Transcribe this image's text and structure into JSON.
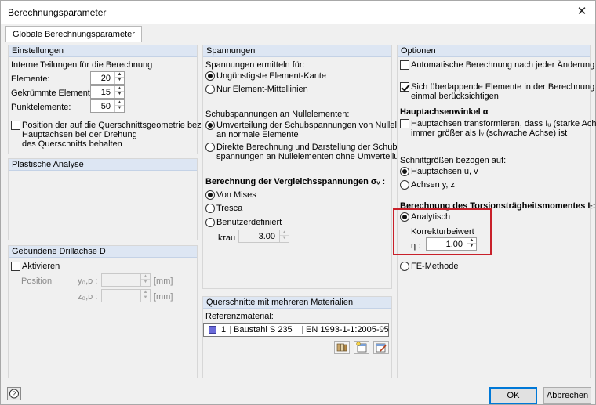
{
  "window": {
    "title": "Berechnungsparameter",
    "close_glyph": "✕"
  },
  "tabs": [
    {
      "label": "Globale Berechnungsparameter"
    }
  ],
  "einstellungen": {
    "header": "Einstellungen",
    "intro": "Interne Teilungen für die Berechnung",
    "elemente_label": "Elemente:",
    "elemente_value": "20",
    "gekruemmte_label": "Gekrümmte Elemente:",
    "gekruemmte_value": "15",
    "punkt_label": "Punktelemente:",
    "punkt_value": "50",
    "position_label_1": "Position der auf die Querschnittsgeometrie bezogenen",
    "position_label_2": "Hauptachsen bei der Drehung",
    "position_label_3": "des Querschnitts behalten",
    "position_checked": false
  },
  "plastische": {
    "header": "Plastische Analyse"
  },
  "drillachse": {
    "header": "Gebundene Drillachse D",
    "aktivieren_label": "Aktivieren",
    "aktivieren_checked": false,
    "position_label": "Position",
    "y_label": "y₀,ᴅ :",
    "y_unit": "[mm]",
    "y_value": "",
    "z_label": "z₀,ᴅ :",
    "z_unit": "[mm]",
    "z_value": ""
  },
  "spannungen": {
    "header": "Spannungen",
    "ermitteln_label": "Spannungen ermitteln für:",
    "opt_ungunstig": "Ungünstigste Element-Kante",
    "opt_ungunstig_checked": true,
    "opt_mittel": "Nur Element-Mittellinien",
    "opt_mittel_checked": false,
    "schub_label": "Schubspannungen an Nullelementen:",
    "opt_umvert_1": "Umverteilung der Schubspannungen von Nullelementen",
    "opt_umvert_2": "an normale Elemente",
    "opt_umvert_checked": true,
    "opt_direkt_1": "Direkte Berechnung und Darstellung der Schub-",
    "opt_direkt_2": "spannungen an Nullelementen ohne Umverteilung",
    "opt_direkt_checked": false,
    "vergleich_label": "Berechnung der Vergleichsspannungen σᵥ :",
    "opt_mises": "Von Mises",
    "opt_mises_checked": true,
    "opt_tresca": "Tresca",
    "opt_tresca_checked": false,
    "opt_benutzer": "Benutzerdefiniert",
    "opt_benutzer_checked": false,
    "ktau_label": "kτau",
    "ktau_value": "3.00"
  },
  "materialien": {
    "header": "Querschnitte mit mehreren Materialien",
    "referenz_label": "Referenzmaterial:",
    "material_no": "1",
    "material_name": "Baustahl S 235",
    "material_norm": "EN 1993-1-1:2005-05",
    "material_color": "#6a6ad8",
    "icons": [
      "library-icon",
      "new-material-icon",
      "edit-material-icon"
    ]
  },
  "optionen": {
    "header": "Optionen",
    "auto_label": "Automatische Berechnung nach jeder Änderung",
    "auto_checked": false,
    "overlap_label_1": "Sich überlappende Elemente in der Berechnung nur",
    "overlap_label_2": "einmal berücksichtigen",
    "overlap_checked": true,
    "hauptachsen_heading": "Hauptachsenwinkel α",
    "transform_label_1": "Hauptachsen transformieren, dass Iᵤ (starke Achse)",
    "transform_label_2": "immer größer als Iᵥ (schwache Achse) ist",
    "transform_checked": false,
    "schnitt_label": "Schnittgrößen bezogen auf:",
    "opt_uv": "Hauptachsen u, v",
    "opt_uv_checked": true,
    "opt_yz": "Achsen y, z",
    "opt_yz_checked": false,
    "torsion_label": "Berechnung des Torsionsträgheitsmomentes Iₜ:",
    "opt_analytisch": "Analytisch",
    "opt_analytisch_checked": true,
    "korrektur_label": "Korrekturbeiwert",
    "eta_label": "η :",
    "eta_value": "1.00",
    "opt_fe": "FE-Methode",
    "opt_fe_checked": false,
    "highlight_color": "#c8202a"
  },
  "footer": {
    "help_glyph": "?",
    "ok_label": "OK",
    "cancel_label": "Abbrechen"
  }
}
